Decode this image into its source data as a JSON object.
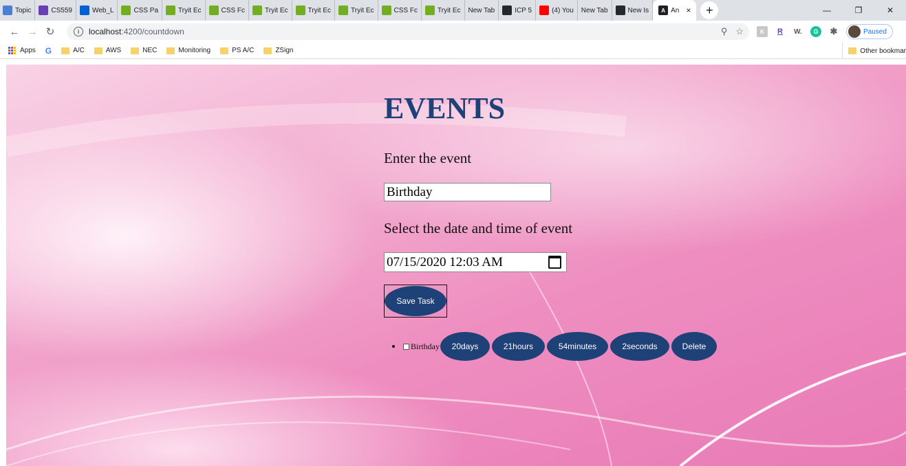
{
  "tabs": [
    {
      "label": "Topic",
      "icon": "canvas-icon",
      "color": "#4a7fd6"
    },
    {
      "label": "CS559",
      "icon": "list-icon",
      "color": "#6a3fb5"
    },
    {
      "label": "Web_L",
      "icon": "box-icon",
      "color": "#0061d5"
    },
    {
      "label": "CSS Pa",
      "icon": "w3-icon",
      "color": "#73ad21"
    },
    {
      "label": "Tryit Ec",
      "icon": "w3-icon",
      "color": "#73ad21"
    },
    {
      "label": "CSS Fc",
      "icon": "w3-icon",
      "color": "#73ad21"
    },
    {
      "label": "Tryit Ec",
      "icon": "w3-icon",
      "color": "#73ad21"
    },
    {
      "label": "Tryit Ec",
      "icon": "w3-icon",
      "color": "#73ad21"
    },
    {
      "label": "Tryit Ec",
      "icon": "w3-icon",
      "color": "#73ad21"
    },
    {
      "label": "CSS Fc",
      "icon": "w3-icon",
      "color": "#73ad21"
    },
    {
      "label": "Tryit Ec",
      "icon": "w3-icon",
      "color": "#73ad21"
    },
    {
      "label": "New Tab",
      "icon": "",
      "color": ""
    },
    {
      "label": "ICP 5",
      "icon": "github-icon",
      "color": "#24292e"
    },
    {
      "label": "(4) You",
      "icon": "youtube-icon",
      "color": "#ff0000"
    },
    {
      "label": "New Tab",
      "icon": "",
      "color": ""
    },
    {
      "label": "New Is",
      "icon": "github-icon",
      "color": "#24292e"
    }
  ],
  "active_tab": {
    "label": "An",
    "icon": "angular-icon",
    "close": "×"
  },
  "new_tab": "+",
  "window_controls": {
    "minimize": "—",
    "restore": "❐",
    "close": "✕"
  },
  "toolbar": {
    "url_host": "localhost",
    "url_path": ":4200/countdown",
    "paused_label": "Paused"
  },
  "bookmarks": {
    "apps": "Apps",
    "items": [
      "A/C",
      "AWS",
      "NEC",
      "Monitoring",
      "PS A/C",
      "ZSign"
    ],
    "other": "Other bookmar"
  },
  "page": {
    "title": "EVENTS",
    "event_label": "Enter the event",
    "event_value": "Birthday",
    "date_label": "Select the date and time of event",
    "date_value": "07/15/2020 12:03 AM",
    "save_label": "Save Task"
  },
  "events": [
    {
      "name": "Birthday",
      "days": "20days",
      "hours": "21hours",
      "minutes": "54minutes",
      "seconds": "2seconds",
      "delete": "Delete"
    }
  ],
  "colors": {
    "accent": "#1e4177",
    "background_pink": "#ee8ec0"
  }
}
